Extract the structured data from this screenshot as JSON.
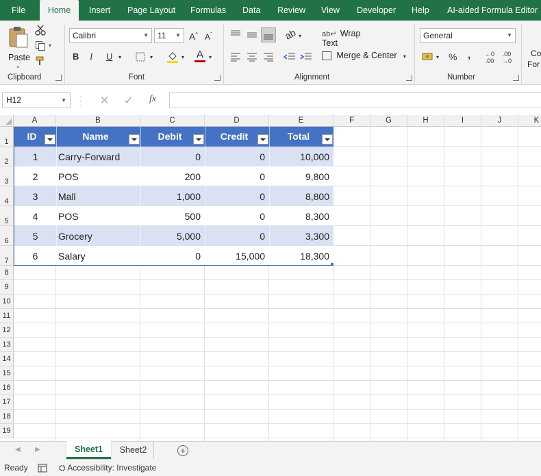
{
  "ribbon_tabs": [
    "File",
    "Home",
    "Insert",
    "Page Layout",
    "Formulas",
    "Data",
    "Review",
    "View",
    "Developer",
    "Help",
    "AI-aided Formula Editor"
  ],
  "clipboard": {
    "paste": "Paste",
    "group": "Clipboard"
  },
  "font": {
    "name": "Calibri",
    "size": "11",
    "group": "Font",
    "bold": "B",
    "italic": "I",
    "underline": "U"
  },
  "alignment": {
    "wrap": "Wrap Text",
    "merge": "Merge & Center",
    "group": "Alignment"
  },
  "number": {
    "format": "General",
    "percent": "%",
    "comma": ",",
    "group": "Number"
  },
  "styles_clip": {
    "line1": "Co",
    "line2": "For"
  },
  "formula_bar": {
    "name_box": "H12",
    "fx": "fx",
    "value": ""
  },
  "columns": [
    "A",
    "B",
    "C",
    "D",
    "E",
    "F",
    "G",
    "H",
    "I",
    "J",
    "K"
  ],
  "rows": [
    "1",
    "2",
    "3",
    "4",
    "5",
    "6",
    "7",
    "8",
    "9",
    "10",
    "11",
    "12",
    "13",
    "14",
    "15",
    "16",
    "17",
    "18",
    "19"
  ],
  "table": {
    "headers": [
      "ID",
      "Name",
      "Debit",
      "Credit",
      "Total"
    ],
    "rows": [
      [
        "1",
        "Carry-Forward",
        "0",
        "0",
        "10,000"
      ],
      [
        "2",
        "POS",
        "200",
        "0",
        "9,800"
      ],
      [
        "3",
        "Mall",
        "1,000",
        "0",
        "8,800"
      ],
      [
        "4",
        "POS",
        "500",
        "0",
        "8,300"
      ],
      [
        "5",
        "Grocery",
        "5,000",
        "0",
        "3,300"
      ],
      [
        "6",
        "Salary",
        "0",
        "15,000",
        "18,300"
      ]
    ]
  },
  "sheets": [
    "Sheet1",
    "Sheet2"
  ],
  "status": {
    "ready": "Ready",
    "accessibility": "Accessibility: Investigate"
  },
  "colors": {
    "accent": "#217346",
    "table_header": "#4472c4",
    "table_band": "#d9e1f2"
  }
}
